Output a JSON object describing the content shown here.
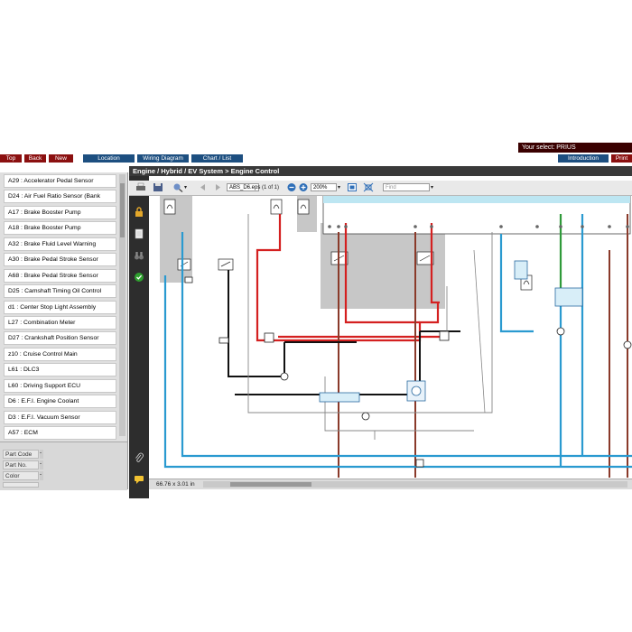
{
  "header": {
    "selection_label": "Your select: PRIUS"
  },
  "nav": {
    "top": "Top",
    "back": "Back",
    "new": "New",
    "location": "Location",
    "wiring_diagram": "Wiring Diagram",
    "chart_list": "Chart / List",
    "introduction": "Introduction",
    "print": "Print"
  },
  "components": [
    "A29 : Accelerator Pedal Sensor",
    "D24 : Air Fuel Ratio Sensor (Bank",
    "A17 : Brake Booster Pump",
    "A18 : Brake Booster Pump",
    "A32 : Brake Fluid Level Warning",
    "A30 : Brake Pedal Stroke Sensor",
    "A68 : Brake Pedal Stroke Sensor",
    "D25 : Camshaft Timing Oil Control",
    "d1 : Center Stop Light Assembly",
    "L27 : Combination Meter",
    "D27 : Crankshaft Position Sensor",
    "z10 : Cruise Control Main",
    "L61 : DLC3",
    "L60 : Driving Support ECU",
    "D6 : E.F.I. Engine Coolant",
    "D3 : E.F.I. Vacuum Sensor",
    "A57 : ECM"
  ],
  "properties": {
    "part_code": "Part Code",
    "part_no": "Part No.",
    "color": "Color",
    "dash": "-"
  },
  "document": {
    "breadcrumb": "Engine / Hybrid / EV System > Engine Control",
    "file_name": "ABS_D6.eps",
    "page_info": "(1 of 1)",
    "zoom": "200%",
    "find_placeholder": "Find",
    "status_size": "66.76 x 3.01 in"
  },
  "colors": {
    "nav_red": "#8b1010",
    "nav_blue": "#1d4f80",
    "wire_red": "#d42020",
    "wire_blue": "#2a9ad0",
    "wire_green": "#2f9a3a",
    "wire_brown": "#8a3a2a",
    "wire_black": "#111111",
    "shade": "#c7c7c7"
  }
}
